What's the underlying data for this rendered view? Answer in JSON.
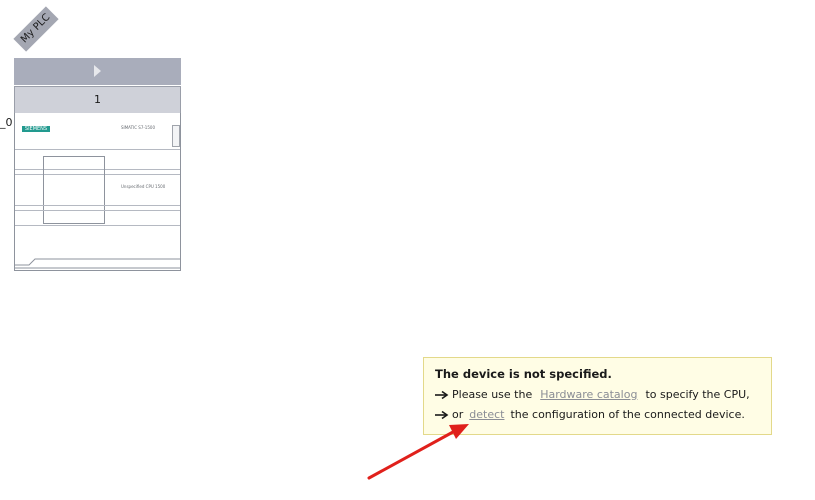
{
  "device": {
    "name": "My PLC",
    "slot_number": "1",
    "rack_stub_label": "_0",
    "brand": "SIEMENS",
    "model_label": "SIMATIC S7-1500",
    "cpu_label": "Unspecified CPU 1500"
  },
  "notice": {
    "title": "The device is not specified.",
    "line1_prefix": "Please use the",
    "line1_link": "Hardware catalog",
    "line1_suffix": "to specify the CPU,",
    "line2_prefix": "or",
    "line2_link": "detect",
    "line2_suffix": "the configuration of the connected device."
  },
  "icons": {
    "notice_bullet": "arrow-right-icon",
    "rack_expand": "chevron-right-icon",
    "annotation": "red-pointer-arrow-icon"
  },
  "colors": {
    "tag_bg": "#a4a7b2",
    "rack_header": "#a9adbb",
    "slot_row": "#cfd1d9",
    "brand_badge": "#229a8f",
    "notice_bg": "#fffde5",
    "notice_border": "#e3d98a",
    "link": "#8a8d95",
    "annotation": "#e0201b"
  }
}
